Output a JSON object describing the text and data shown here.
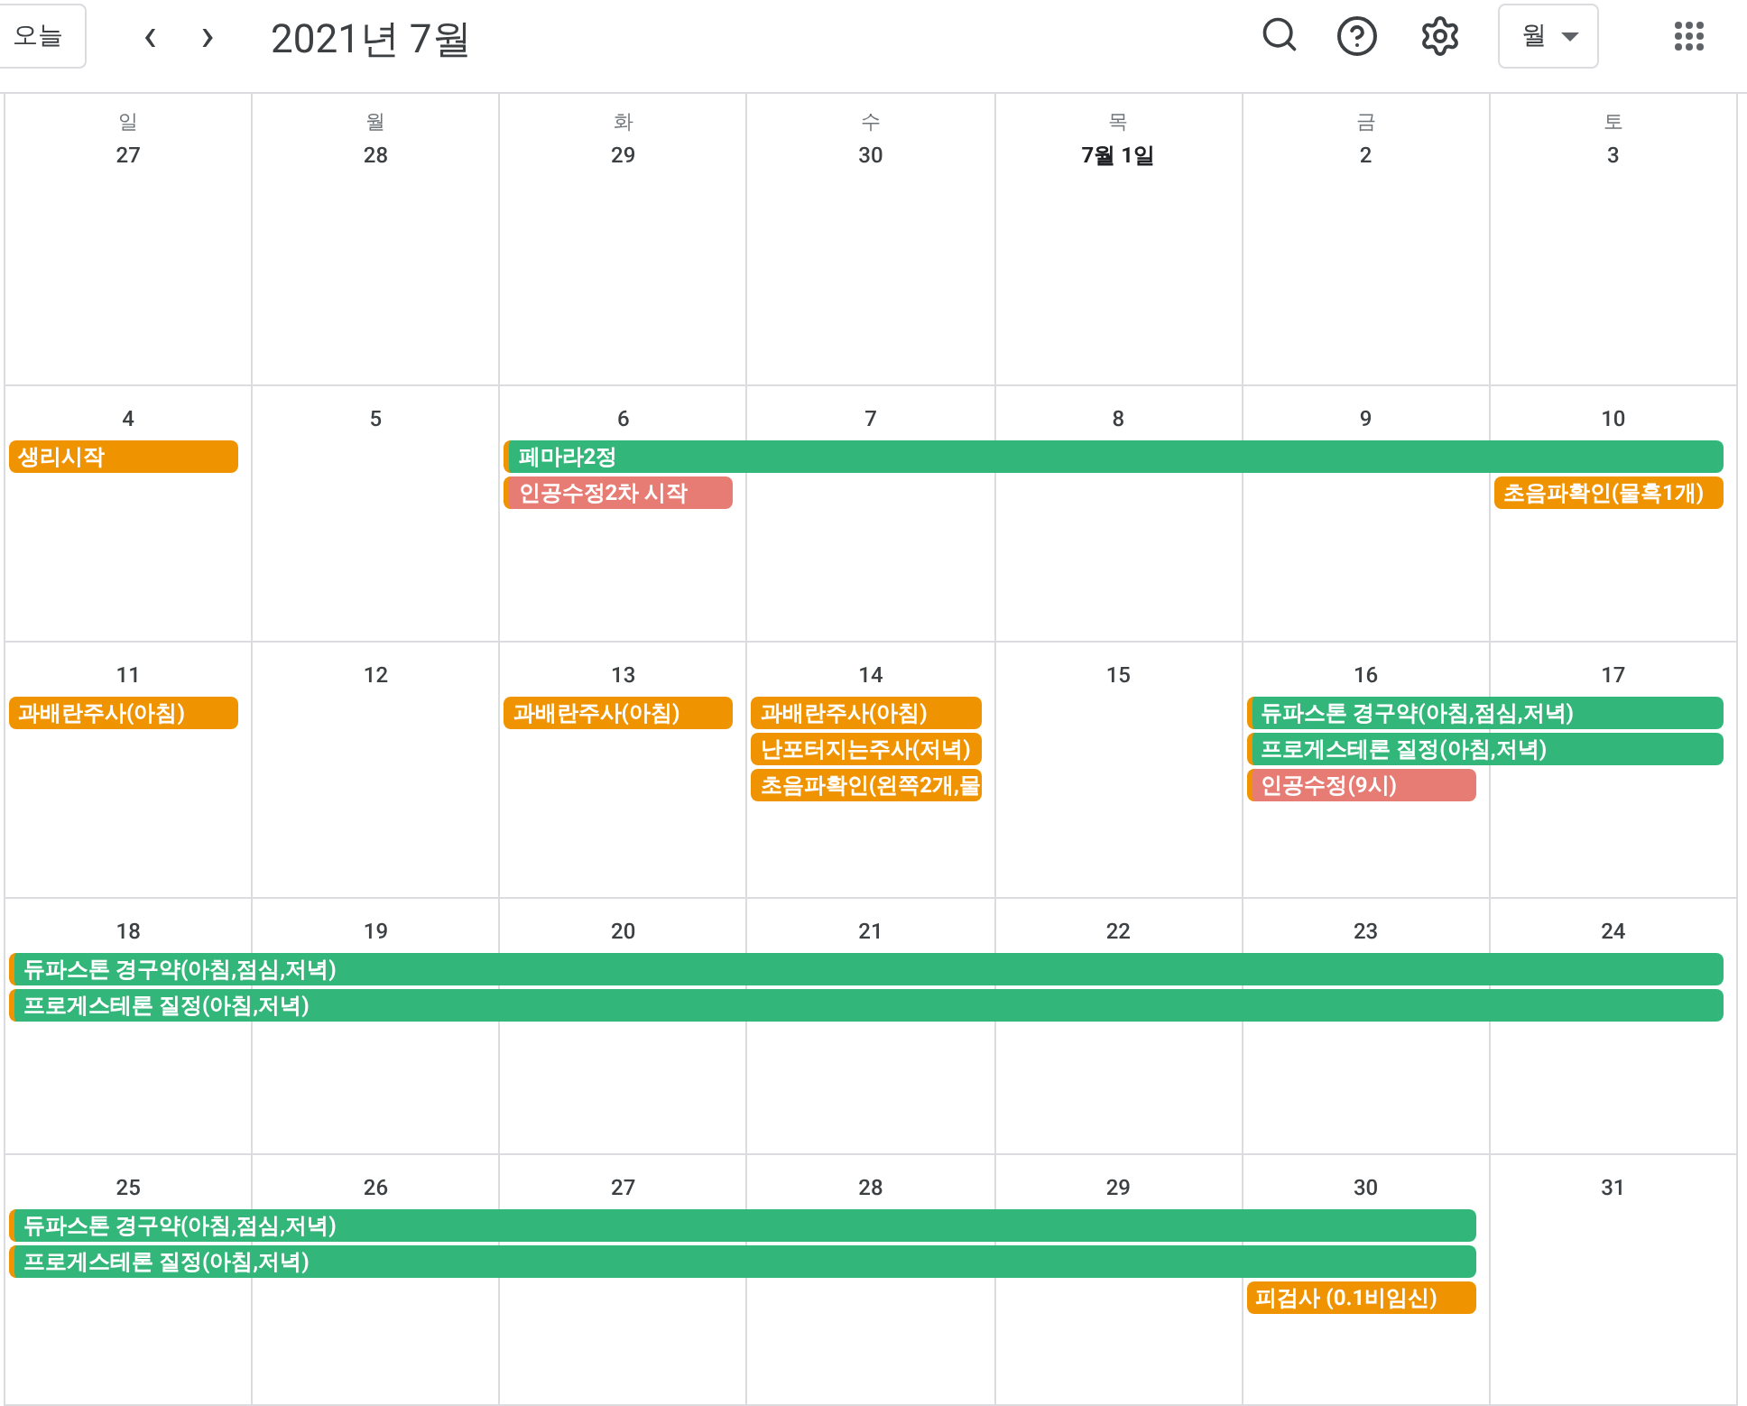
{
  "toolbar": {
    "today_button": "오늘",
    "prev": "‹",
    "next": "›",
    "title": "2021년 7월",
    "view_selector": "월"
  },
  "weekdays": [
    "일",
    "월",
    "화",
    "수",
    "목",
    "금",
    "토"
  ],
  "weeks": [
    {
      "days": [
        {
          "date": "27",
          "emphasis": false
        },
        {
          "date": "28",
          "emphasis": false
        },
        {
          "date": "29",
          "emphasis": false
        },
        {
          "date": "30",
          "emphasis": false
        },
        {
          "date": "7월 1일",
          "emphasis": true
        },
        {
          "date": "2",
          "emphasis": false
        },
        {
          "date": "3",
          "emphasis": false
        }
      ]
    },
    {
      "days": [
        {
          "date": "4",
          "emphasis": false,
          "lanes": [
            {
              "kind": "start",
              "title": "생리시작",
              "color": "#f09300",
              "accent": false
            }
          ]
        },
        {
          "date": "5",
          "emphasis": false
        },
        {
          "date": "6",
          "emphasis": false,
          "lanes": [
            {
              "kind": "start",
              "title": "페마라2정",
              "color": "#33b679",
              "accent": true
            },
            {
              "kind": "start",
              "title": "인공수정2차 시작",
              "color": "#e67c73",
              "accent": true
            }
          ]
        },
        {
          "date": "7",
          "emphasis": false,
          "lanes": [
            {
              "kind": "continued"
            }
          ]
        },
        {
          "date": "8",
          "emphasis": false,
          "lanes": [
            {
              "kind": "continued"
            }
          ]
        },
        {
          "date": "9",
          "emphasis": false,
          "lanes": [
            {
              "kind": "continued"
            }
          ]
        },
        {
          "date": "10",
          "emphasis": false,
          "lanes": [
            {
              "kind": "continued"
            },
            {
              "kind": "start",
              "title": "초음파확인(물혹1개)",
              "color": "#f09300",
              "accent": false
            }
          ]
        }
      ]
    },
    {
      "days": [
        {
          "date": "11",
          "emphasis": false,
          "lanes": [
            {
              "kind": "start",
              "title": "과배란주사(아침)",
              "color": "#f09300",
              "accent": false
            }
          ]
        },
        {
          "date": "12",
          "emphasis": false
        },
        {
          "date": "13",
          "emphasis": false,
          "lanes": [
            {
              "kind": "start",
              "title": "과배란주사(아침)",
              "color": "#f09300",
              "accent": false
            }
          ]
        },
        {
          "date": "14",
          "emphasis": false,
          "lanes": [
            {
              "kind": "start",
              "title": "과배란주사(아침)",
              "color": "#f09300",
              "accent": false
            },
            {
              "kind": "start",
              "title": "난포터지는주사(저녁)",
              "color": "#f09300",
              "accent": false
            },
            {
              "kind": "start",
              "title": "초음파확인(왼쪽2개,물",
              "color": "#f09300",
              "accent": false
            }
          ]
        },
        {
          "date": "15",
          "emphasis": false
        },
        {
          "date": "16",
          "emphasis": false,
          "lanes": [
            {
              "kind": "start",
              "title": "듀파스톤 경구약(아침,점심,저녁)",
              "color": "#33b679",
              "accent": true
            },
            {
              "kind": "start",
              "title": "프로게스테론 질정(아침,저녁)",
              "color": "#33b679",
              "accent": true
            },
            {
              "kind": "start",
              "title": "인공수정(9시)",
              "color": "#e67c73",
              "accent": true
            }
          ]
        },
        {
          "date": "17",
          "emphasis": false,
          "lanes": [
            {
              "kind": "continued"
            },
            {
              "kind": "continued"
            }
          ]
        }
      ]
    },
    {
      "days": [
        {
          "date": "18",
          "emphasis": false,
          "lanes": [
            {
              "kind": "start",
              "title": "듀파스톤 경구약(아침,점심,저녁)",
              "color": "#33b679",
              "accent": true
            },
            {
              "kind": "start",
              "title": "프로게스테론 질정(아침,저녁)",
              "color": "#33b679",
              "accent": true
            }
          ]
        },
        {
          "date": "19",
          "emphasis": false,
          "lanes": [
            {
              "kind": "continued"
            },
            {
              "kind": "continued"
            }
          ]
        },
        {
          "date": "20",
          "emphasis": false,
          "lanes": [
            {
              "kind": "continued"
            },
            {
              "kind": "continued"
            }
          ]
        },
        {
          "date": "21",
          "emphasis": false,
          "lanes": [
            {
              "kind": "continued"
            },
            {
              "kind": "continued"
            }
          ]
        },
        {
          "date": "22",
          "emphasis": false,
          "lanes": [
            {
              "kind": "continued"
            },
            {
              "kind": "continued"
            }
          ]
        },
        {
          "date": "23",
          "emphasis": false,
          "lanes": [
            {
              "kind": "continued"
            },
            {
              "kind": "continued"
            }
          ]
        },
        {
          "date": "24",
          "emphasis": false,
          "lanes": [
            {
              "kind": "continued"
            },
            {
              "kind": "continued"
            }
          ]
        }
      ]
    },
    {
      "days": [
        {
          "date": "25",
          "emphasis": false,
          "lanes": [
            {
              "kind": "start",
              "title": "듀파스톤 경구약(아침,점심,저녁)",
              "color": "#33b679",
              "accent": true
            },
            {
              "kind": "start",
              "title": "프로게스테론 질정(아침,저녁)",
              "color": "#33b679",
              "accent": true
            }
          ]
        },
        {
          "date": "26",
          "emphasis": false,
          "lanes": [
            {
              "kind": "continued"
            },
            {
              "kind": "continued"
            }
          ]
        },
        {
          "date": "27",
          "emphasis": false,
          "lanes": [
            {
              "kind": "continued"
            },
            {
              "kind": "continued"
            }
          ]
        },
        {
          "date": "28",
          "emphasis": false,
          "lanes": [
            {
              "kind": "continued"
            },
            {
              "kind": "continued"
            }
          ]
        },
        {
          "date": "29",
          "emphasis": false,
          "lanes": [
            {
              "kind": "continued"
            },
            {
              "kind": "continued"
            }
          ]
        },
        {
          "date": "30",
          "emphasis": false,
          "lanes": [
            {
              "kind": "continued"
            },
            {
              "kind": "continued"
            },
            {
              "kind": "start",
              "title": "피검사 (0.1비임신)",
              "color": "#f09300",
              "accent": false
            }
          ]
        },
        {
          "date": "31",
          "emphasis": false
        }
      ]
    }
  ]
}
